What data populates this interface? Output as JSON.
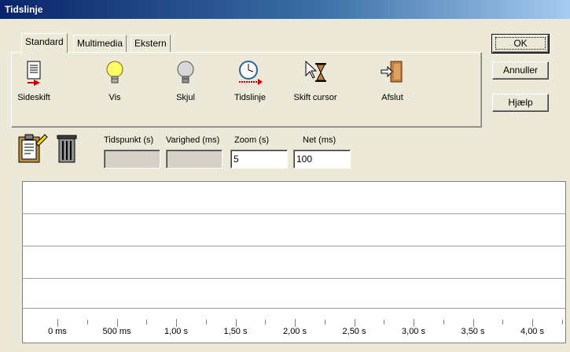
{
  "window": {
    "title": "Tidslinje"
  },
  "tabs": [
    {
      "label": "Standard",
      "active": true
    },
    {
      "label": "Multimedia",
      "active": false
    },
    {
      "label": "Ekstern",
      "active": false
    }
  ],
  "toolbar": [
    {
      "label": "Sideskift",
      "icon": "page-break-icon"
    },
    {
      "label": "Vis",
      "icon": "lightbulb-on-icon"
    },
    {
      "label": "Skjul",
      "icon": "lightbulb-off-icon"
    },
    {
      "label": "Tidslinje",
      "icon": "clock-timeline-icon"
    },
    {
      "label": "Skift cursor",
      "icon": "cursor-hourglass-icon"
    },
    {
      "label": "Afslut",
      "icon": "exit-door-icon"
    }
  ],
  "buttons": {
    "ok": "OK",
    "cancel": "Annuller",
    "help": "Hjælp"
  },
  "fields": {
    "tidspunkt": {
      "label": "Tidspunkt (s)",
      "value": ""
    },
    "varighed": {
      "label": "Varighed (ms)",
      "value": ""
    },
    "zoom": {
      "label": "Zoom (s)",
      "value": "5"
    },
    "net": {
      "label": "Net (ms)",
      "value": "100"
    }
  },
  "ruler": [
    "0 ms",
    "500 ms",
    "1,00 s",
    "1,50 s",
    "2,00 s",
    "2,50 s",
    "3,00 s",
    "3,50 s",
    "4,00 s"
  ]
}
